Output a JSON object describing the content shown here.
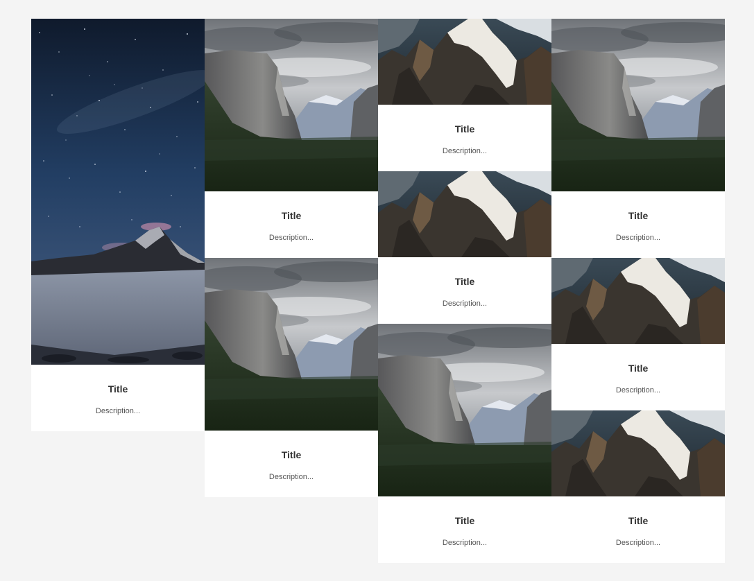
{
  "gallery": {
    "cards": [
      {
        "title": "Title",
        "description": "Description...",
        "image": "starry-mountain-photo"
      },
      {
        "title": "Title",
        "description": "Description...",
        "image": "valley-photo"
      },
      {
        "title": "Title",
        "description": "Description...",
        "image": "valley-photo"
      },
      {
        "title": "Title",
        "description": "Description...",
        "image": "snowy-peaks-photo"
      },
      {
        "title": "Title",
        "description": "Description...",
        "image": "snowy-peaks-photo"
      },
      {
        "title": "Title",
        "description": "Description...",
        "image": "valley-photo"
      },
      {
        "title": "Title",
        "description": "Description...",
        "image": "valley-photo"
      },
      {
        "title": "Title",
        "description": "Description...",
        "image": "snowy-peaks-photo"
      },
      {
        "title": "Title",
        "description": "Description...",
        "image": "snowy-peaks-photo"
      }
    ]
  }
}
